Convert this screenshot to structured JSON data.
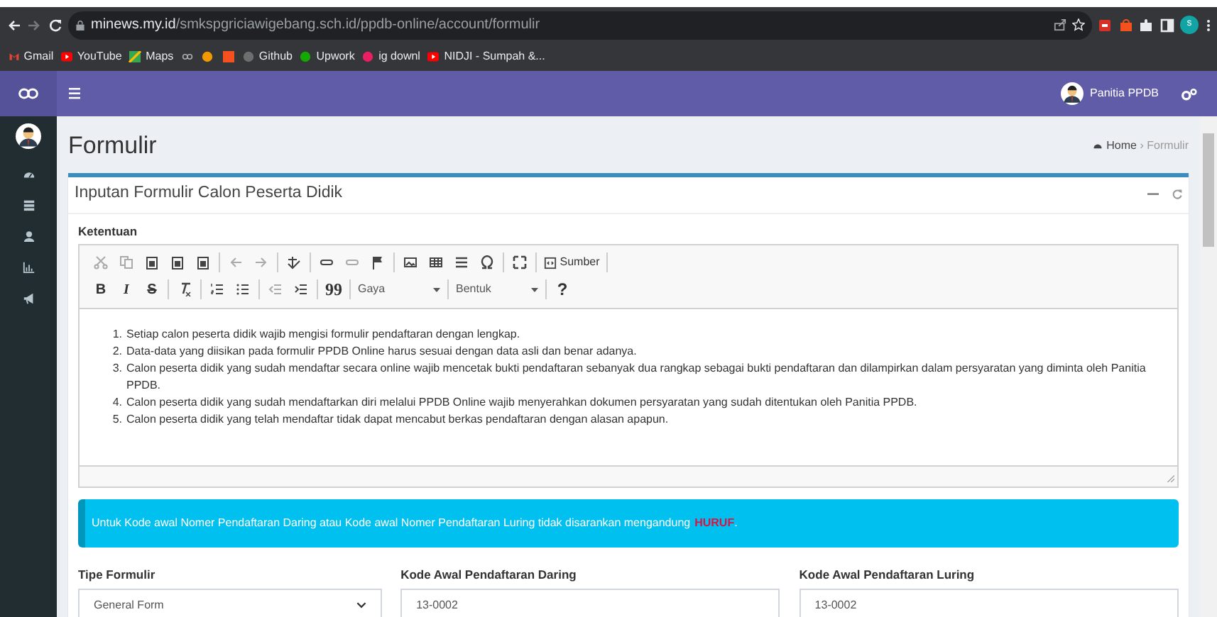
{
  "browser": {
    "url_host": "minews.my.id",
    "url_path": "/smkspgriciawigebang.sch.id/ppdb-online/account/formulir",
    "profile_letter": "s",
    "bookmarks": [
      {
        "kind": "gmail",
        "label": "Gmail"
      },
      {
        "kind": "youtube",
        "label": "YouTube"
      },
      {
        "kind": "maps",
        "label": "Maps"
      },
      {
        "kind": "glasses"
      },
      {
        "kind": "orange"
      },
      {
        "kind": "square"
      },
      {
        "kind": "github",
        "label": "Github"
      },
      {
        "kind": "upwork",
        "label": "Upwork"
      },
      {
        "kind": "pink",
        "label": "ig downl"
      },
      {
        "kind": "youtube",
        "label": "NIDJI - Sumpah &..."
      }
    ]
  },
  "navbar": {
    "user": "Panitia PPDB"
  },
  "page": {
    "title": "Formulir",
    "breadcrumb": [
      "Home",
      "Formulir"
    ],
    "separator": "›"
  },
  "box": {
    "title": "Inputan Formulir Calon Peserta Didik",
    "section_label": "Ketentuan"
  },
  "editor": {
    "source_label": "Sumber",
    "bold": "B",
    "italic": "I",
    "strike": "S",
    "quote": "99",
    "style_select": "Gaya",
    "format_select": "Bentuk",
    "help": "?",
    "items": [
      {
        "number": "1.",
        "text": "Setiap calon peserta didik wajib mengisi formulir pendaftaran dengan lengkap."
      },
      {
        "number": "2.",
        "text": "Data-data yang diisikan pada formulir PPDB Online harus sesuai dengan data asli dan benar adanya."
      },
      {
        "number": "3.",
        "text": "Calon peserta didik yang sudah mendaftar secara online wajib mencetak bukti pendaftaran sebanyak dua rangkap sebagai bukti pendaftaran dan dilampirkan dalam persyaratan yang diminta oleh Panitia PPDB."
      },
      {
        "number": "4.",
        "text": "Calon peserta didik yang sudah mendaftarkan diri melalui PPDB Online wajib menyerahkan dokumen persyaratan yang sudah ditentukan oleh Panitia PPDB."
      },
      {
        "number": "5.",
        "text": "Calon peserta didik yang telah mendaftar tidak dapat mencabut berkas pendaftaran dengan alasan apapun."
      }
    ]
  },
  "callout": {
    "parts": [
      {
        "kind": "plain",
        "text": "Untuk Kode awal Nomer Pendaftaran Daring atau Kode awal Nomer Pendaftaran Luring tidak disarankan mengandung"
      },
      {
        "kind": "highlight",
        "text": "HURUF"
      },
      {
        "kind": "plain",
        "text": "."
      }
    ]
  },
  "fields": [
    {
      "kind": "select",
      "label": "Tipe Formulir",
      "value": "General Form"
    },
    {
      "kind": "input",
      "label": "Kode Awal Pendaftaran Daring",
      "value": "13-0002"
    },
    {
      "kind": "input",
      "label": "Kode Awal Pendaftaran Luring",
      "value": "13-0002"
    }
  ]
}
